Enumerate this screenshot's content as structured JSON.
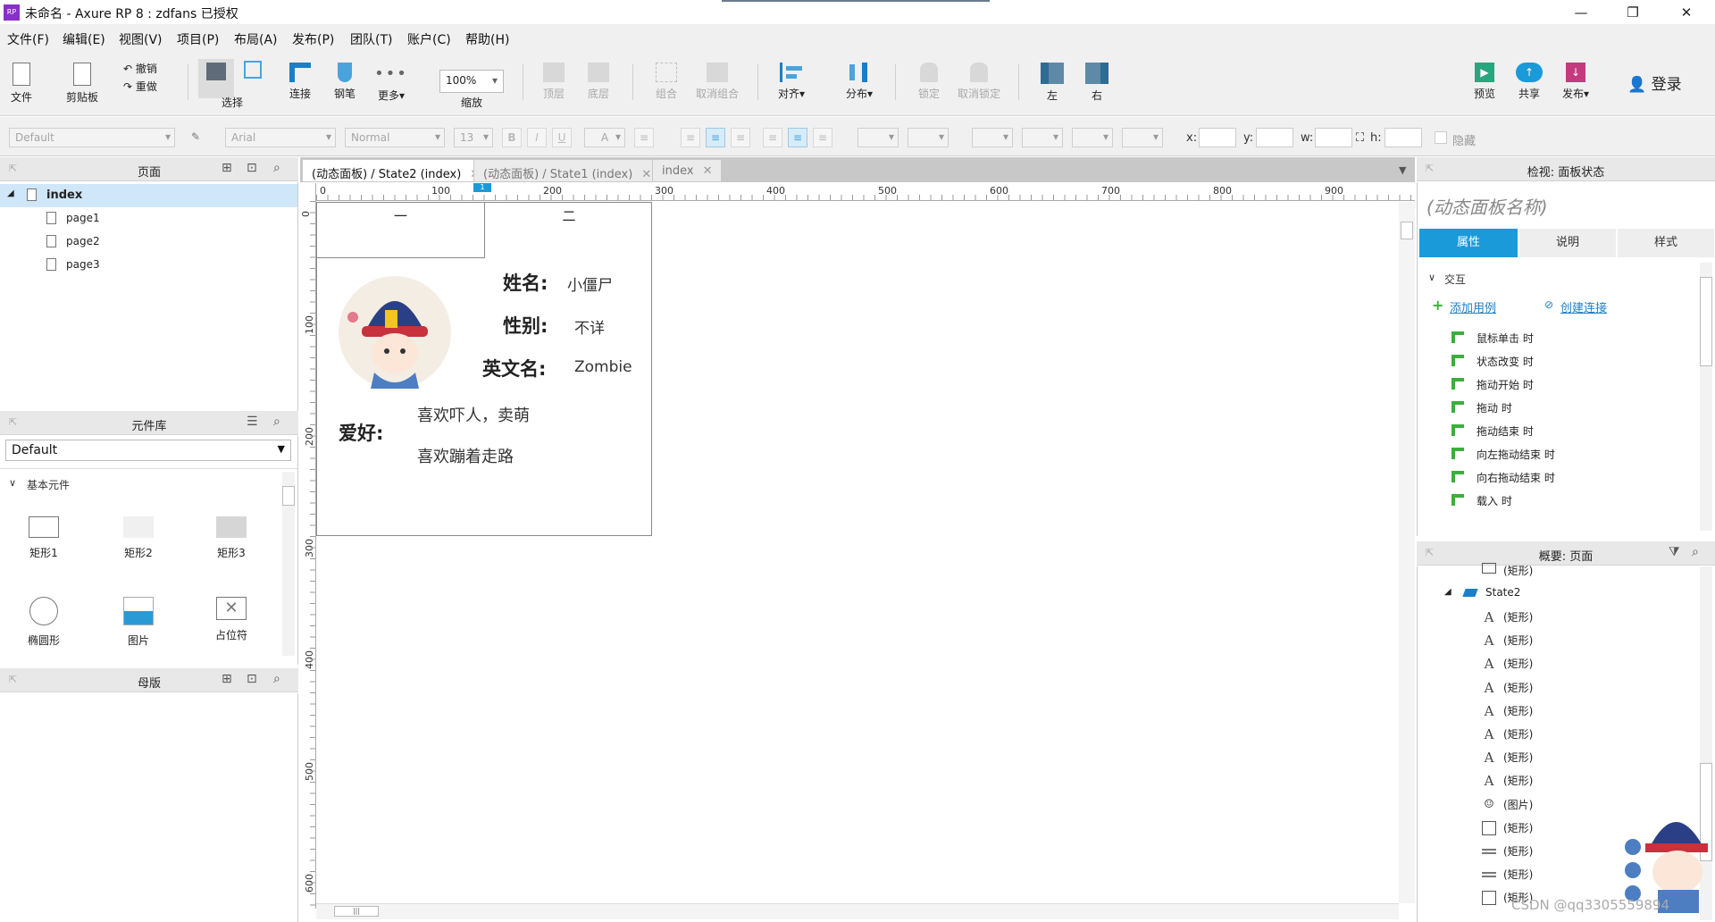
{
  "window": {
    "title": "未命名 - Axure RP 8 : zdfans 已授权",
    "logo_text": "RP",
    "minimize": "—",
    "restore": "❐",
    "close": "✕"
  },
  "menu": [
    "文件(F)",
    "编辑(E)",
    "视图(V)",
    "项目(P)",
    "布局(A)",
    "发布(P)",
    "团队(T)",
    "账户(C)",
    "帮助(H)"
  ],
  "toolbar": {
    "file": "文件",
    "clipboard": "剪贴板",
    "undo": "撤销",
    "redo": "重做",
    "select": "选择",
    "connect": "连接",
    "pen": "钢笔",
    "more": "更多▾",
    "zoom_value": "100%",
    "zoom": "缩放",
    "top": "顶层",
    "bottom": "底层",
    "group": "组合",
    "ungroup": "取消组合",
    "align": "对齐▾",
    "distribute": "分布▾",
    "lock": "锁定",
    "unlock": "取消锁定",
    "left": "左",
    "right": "右",
    "preview": "预览",
    "share": "共享",
    "publish": "发布▾",
    "login": "登录"
  },
  "format": {
    "style": "Default",
    "font": "Arial",
    "weight": "Normal",
    "size": "13",
    "bold": "B",
    "italic": "I",
    "underline": "U",
    "font_color": "A",
    "x_label": "x:",
    "y_label": "y:",
    "w_label": "w:",
    "h_label": "h:",
    "hidden": "隐藏"
  },
  "pages_panel": {
    "title": "页面",
    "items": [
      "index",
      "page1",
      "page2",
      "page3"
    ]
  },
  "library_panel": {
    "title": "元件库",
    "selected": "Default",
    "section": "基本元件",
    "widgets": [
      "矩形1",
      "矩形2",
      "矩形3",
      "椭圆形",
      "图片",
      "占位符"
    ]
  },
  "masters_panel": {
    "title": "母版"
  },
  "tabs": [
    {
      "label": "(动态面板) / State2 (index)",
      "active": true
    },
    {
      "label": "(动态面板) / State1 (index)",
      "active": false
    },
    {
      "label": "index",
      "active": false
    }
  ],
  "ruler": {
    "h": [
      "0",
      "100",
      "200",
      "300",
      "400",
      "500",
      "600",
      "700",
      "800",
      "900"
    ],
    "v": [
      "0",
      "100",
      "200",
      "300",
      "400",
      "500",
      "600"
    ]
  },
  "card": {
    "tab1": "一",
    "tab2": "二",
    "name_label": "姓名:",
    "name_value": "小僵尸",
    "gender_label": "性别:",
    "gender_value": "不详",
    "english_label": "英文名:",
    "english_value": "Zombie",
    "hobby_label": "爱好:",
    "hobby1": "喜欢吓人，卖萌",
    "hobby2": "喜欢蹦着走路",
    "selection_marker": "1"
  },
  "inspector": {
    "title": "检视: 面板状态",
    "name_placeholder": "(动态面板名称)",
    "tabs": [
      "属性",
      "说明",
      "样式"
    ],
    "section": "交互",
    "add_case": "添加用例",
    "create_link": "创建连接",
    "events": [
      "鼠标单击 时",
      "状态改变 时",
      "拖动开始 时",
      "拖动 时",
      "拖动结束 时",
      "向左拖动结束 时",
      "向右拖动结束 时",
      "载入 时"
    ]
  },
  "outline": {
    "title": "概要: 页面",
    "top_partial": "(矩形)",
    "state": "State2",
    "items": [
      {
        "icon": "text",
        "label": "(矩形)"
      },
      {
        "icon": "text",
        "label": "(矩形)"
      },
      {
        "icon": "text",
        "label": "(矩形)"
      },
      {
        "icon": "text",
        "label": "(矩形)"
      },
      {
        "icon": "text",
        "label": "(矩形)"
      },
      {
        "icon": "text",
        "label": "(矩形)"
      },
      {
        "icon": "text",
        "label": "(矩形)"
      },
      {
        "icon": "text",
        "label": "(矩形)"
      },
      {
        "icon": "image",
        "label": "(图片)"
      },
      {
        "icon": "box",
        "label": "(矩形)"
      },
      {
        "icon": "line",
        "label": "(矩形)"
      },
      {
        "icon": "line",
        "label": "(矩形)"
      },
      {
        "icon": "box",
        "label": "(矩形)"
      }
    ]
  },
  "watermark": "CSDN @qq3305559894",
  "colors": {
    "accent": "#1a9ad9",
    "link": "#1a7fc7",
    "green": "#3cae3c",
    "selection": "#cfe7f8"
  }
}
